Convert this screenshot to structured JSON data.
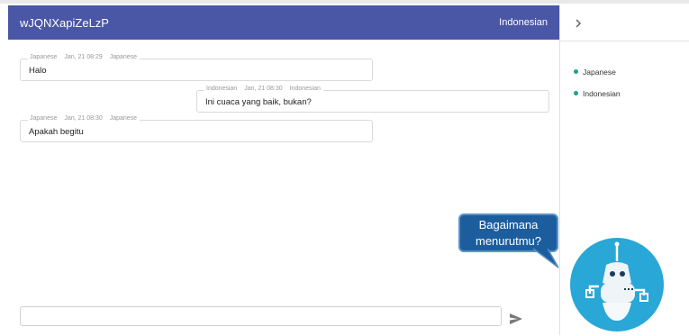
{
  "header": {
    "title": "wJQNXapiZeLzP",
    "current_language": "Indonesian"
  },
  "messages": [
    {
      "source_lang": "Japanese",
      "time": "Jan, 21 08:29",
      "target_lang": "Japanese",
      "text": "Halo"
    },
    {
      "source_lang": "Indonesian",
      "time": "Jan, 21 08:30",
      "target_lang": "Indonesian",
      "text": "Ini cuaca yang baik, bukan?"
    },
    {
      "source_lang": "Japanese",
      "time": "Jan, 21 08:30",
      "target_lang": "Japanese",
      "text": "Apakah begitu"
    }
  ],
  "side_panel": {
    "toggle_icon": "chevron-right-icon",
    "languages": [
      "Japanese",
      "Indonesian"
    ]
  },
  "input": {
    "value": "",
    "placeholder": ""
  },
  "send_icon": "send-icon",
  "assistant": {
    "bubble_line1": "Bagaimana",
    "bubble_line2": "menurutmu?",
    "icon": "robot-icon"
  },
  "colors": {
    "header": "#4a57a6",
    "status_dot": "#1aa38a",
    "bubble": "#1c5d9e",
    "robot_circle": "#29a7d6"
  }
}
